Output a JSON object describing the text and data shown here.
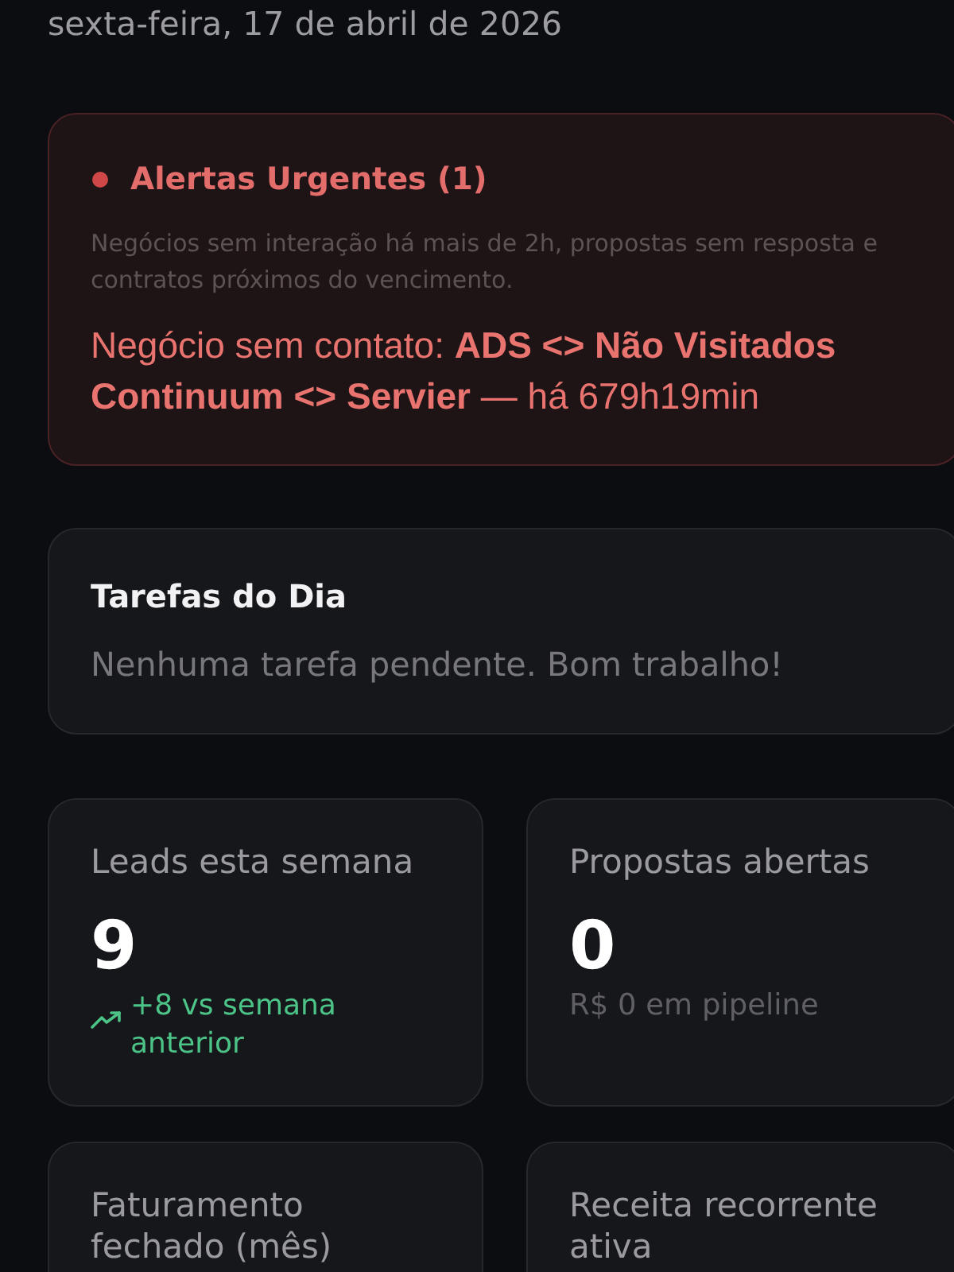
{
  "header": {
    "date": "sexta-feira, 17 de abril de 2026"
  },
  "alerts_card": {
    "title": "Alertas Urgentes (1)",
    "description": "Negócios sem interação há mais de 2h, propostas sem resposta e contratos próximos do vencimento.",
    "items": [
      "Negócio sem contato: **ADS <> Não Visitados Continuum <> Servier** — há 679h19min"
    ]
  },
  "tasks_card": {
    "title": "Tarefas do Dia",
    "empty_message": "Nenhuma tarefa pendente. Bom trabalho!"
  },
  "stats": [
    {
      "kind": "trend",
      "label": "Leads esta semana",
      "value": "9",
      "trend": "+8 vs semana anterior"
    },
    {
      "kind": "note",
      "label": "Propostas abertas",
      "value": "0",
      "note": "R$ 0 em pipeline"
    },
    {
      "kind": "label_only",
      "label": "Faturamento fechado (mês)"
    },
    {
      "kind": "label_only",
      "label": "Receita recorrente ativa"
    }
  ]
}
